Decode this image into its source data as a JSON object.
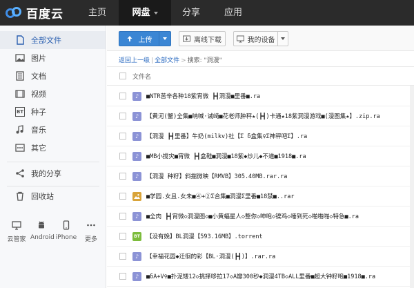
{
  "brand": {
    "name": "百度云",
    "logo_icon": "cloud-logo-icon"
  },
  "top_nav": {
    "tabs": [
      {
        "label": "主页"
      },
      {
        "label": "网盘",
        "active": true
      },
      {
        "label": "分享"
      },
      {
        "label": "应用"
      }
    ]
  },
  "sidebar": {
    "items": [
      {
        "label": "全部文件",
        "icon": "file-icon",
        "active": true
      },
      {
        "label": "图片",
        "icon": "image-icon"
      },
      {
        "label": "文档",
        "icon": "document-icon"
      },
      {
        "label": "视频",
        "icon": "video-icon"
      },
      {
        "label": "种子",
        "icon": "bt-icon",
        "icon_text": "BT"
      },
      {
        "label": "音乐",
        "icon": "music-icon"
      },
      {
        "label": "其它",
        "icon": "more-icon"
      },
      {
        "label": "我的分享",
        "icon": "share-icon"
      },
      {
        "label": "回收站",
        "icon": "trash-icon"
      }
    ],
    "devices": [
      {
        "label": "云管家",
        "icon": "monitor-icon"
      },
      {
        "label": "Android",
        "icon": "android-icon"
      },
      {
        "label": "iPhone",
        "icon": "phone-icon"
      },
      {
        "label": "更多",
        "icon": "dots-icon"
      }
    ]
  },
  "toolbar": {
    "upload_label": "上传",
    "offline_label": "离线下载",
    "device_label": "我的设备"
  },
  "breadcrumb": {
    "back": "返回上一级",
    "all_files": "全部文件",
    "search_text": "搜索: \"洞漫\""
  },
  "list": {
    "column_name": "文件名",
    "files": [
      {
        "type": "music",
        "name": "■NTR苦辛各种18紫宵微 ┣┫洞漫■里番■.ra"
      },
      {
        "type": "music",
        "name": "【黄河(蟹)全集■呐喊·诫崎■花老师肿秤★(┣┫)卡通★18紫洞漫游戏■(漫图集★】.zip.ra"
      },
      {
        "type": "music",
        "name": "【洞漫 ┣┫里番】牛奶(milkv)社【Σ δ盒集♀Σ神秤吧Σ】.ra"
      },
      {
        "type": "music",
        "name": "■MB小搅灾■宵微 ┣┫盒鞋■洞漫■18紫◆炒儿◆不道■1918■.ra"
      },
      {
        "type": "music",
        "name": "【洞漫 种籽】斜揣微映【RMVB】305.40MB.rar.ra"
      },
      {
        "type": "image",
        "name": "■学园.女且.女未■④+②Σ合集■洞漫Σ里番■18禁■..rar"
      },
      {
        "type": "music",
        "name": "■全肉 ┣┫宵微◇洞漫图◇■小黄蝠星人◇整你◇呻咆◇镍鸡◇唾到死◇啪啪啪◇特急■.ra"
      },
      {
        "type": "bt",
        "name": "【没有娩】BL洞漫【593.16MB】.torrent"
      },
      {
        "type": "music",
        "name": "【幸福花园◆迁徊的彩【BL·洞漫(┣┫)】.rar.ra"
      },
      {
        "type": "music",
        "name": "■δA+V♀■扑泥矮12◇挑择哆拉17◇A瓣300秒◆洞漫4TB◇ALL里番■超大钟籽咆■1918■.ra"
      }
    ]
  },
  "colors": {
    "topbar": "#2b2b2b",
    "accent_blue": "#3b86d4",
    "link_blue": "#2a6ac0",
    "music_icon": "#8c93d6",
    "bt_icon": "#7cbc3c"
  }
}
